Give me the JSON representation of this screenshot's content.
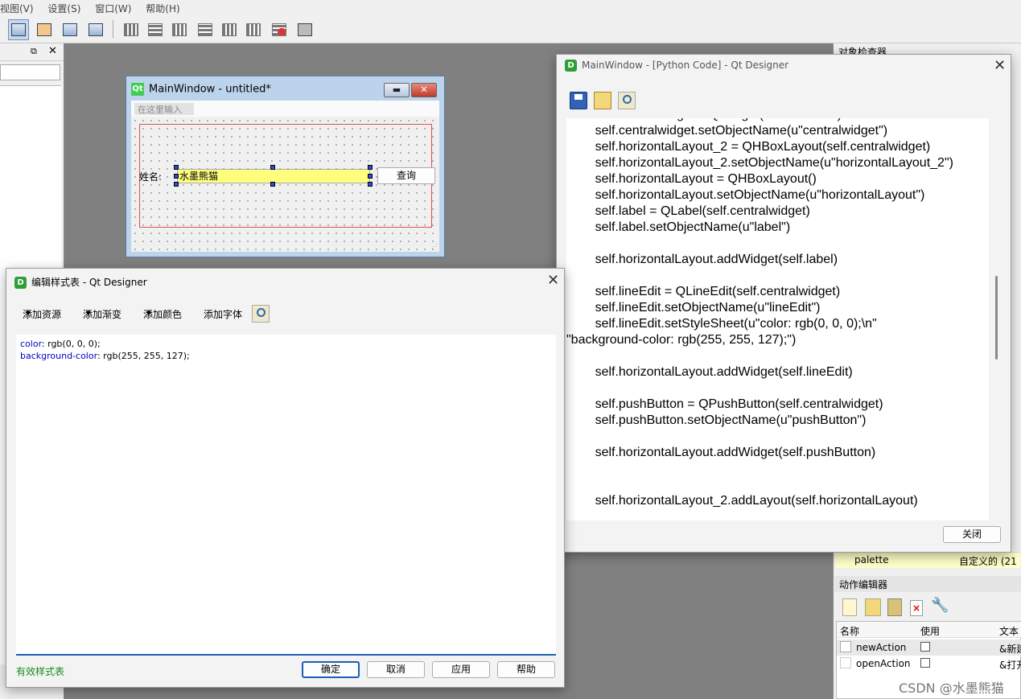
{
  "menubar": [
    "视图(V)",
    "设置(S)",
    "窗口(W)",
    "帮助(H)"
  ],
  "form_window": {
    "title": "MainWindow - untitled*",
    "menu_placeholder": "在这里输入",
    "label": "姓名:",
    "lineedit_value": "水墨熊猫",
    "button": "查询"
  },
  "stylesheet_dialog": {
    "title": "编辑样式表 - Qt Designer",
    "tools": [
      "添加资源",
      "添加渐变",
      "添加颜色",
      "添加字体"
    ],
    "lines": [
      {
        "prop": "color",
        "value": " rgb(0, 0, 0);"
      },
      {
        "prop": "background-color",
        "value": " rgb(255, 255, 127);"
      }
    ],
    "status": "有效样式表",
    "buttons": [
      "确定",
      "取消",
      "应用",
      "帮助"
    ]
  },
  "code_window": {
    "title": "MainWindow - [Python Code] - Qt Designer",
    "close_button": "关闭",
    "lines": [
      "        self.centralwidget = QWidget(MainWindow)",
      "        self.centralwidget.setObjectName(u\"centralwidget\")",
      "        self.horizontalLayout_2 = QHBoxLayout(self.centralwidget)",
      "        self.horizontalLayout_2.setObjectName(u\"horizontalLayout_2\")",
      "        self.horizontalLayout = QHBoxLayout()",
      "        self.horizontalLayout.setObjectName(u\"horizontalLayout\")",
      "        self.label = QLabel(self.centralwidget)",
      "        self.label.setObjectName(u\"label\")",
      "",
      "        self.horizontalLayout.addWidget(self.label)",
      "",
      "        self.lineEdit = QLineEdit(self.centralwidget)",
      "        self.lineEdit.setObjectName(u\"lineEdit\")",
      "        self.lineEdit.setStyleSheet(u\"color: rgb(0, 0, 0);\\n\"",
      "\"background-color: rgb(255, 255, 127);\")",
      "",
      "        self.horizontalLayout.addWidget(self.lineEdit)",
      "",
      "        self.pushButton = QPushButton(self.centralwidget)",
      "        self.pushButton.setObjectName(u\"pushButton\")",
      "",
      "        self.horizontalLayout.addWidget(self.pushButton)",
      "",
      "",
      "        self.horizontalLayout_2.addLayout(self.horizontalLayout)"
    ]
  },
  "right_dock": {
    "object_inspector_title": "对象检查器",
    "property_row": {
      "name": "palette",
      "value": "自定义的 (21"
    },
    "action_editor_title": "动作编辑器",
    "action_columns": [
      "名称",
      "使用",
      "文本"
    ],
    "actions": [
      {
        "name": "newAction",
        "text": "&新建"
      },
      {
        "name": "openAction",
        "text": "&打开"
      }
    ]
  },
  "watermark": "CSDN @水墨熊猫",
  "colors": {
    "lineedit_bg": "#ffff7f",
    "selection": "#1b5fb5"
  }
}
